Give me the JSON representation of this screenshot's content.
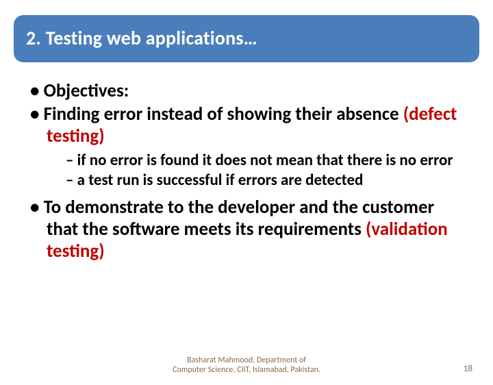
{
  "title": "2. Testing web applications…",
  "bullets": {
    "b1": "Objectives:",
    "b2_pre": "Finding error instead of showing their absence ",
    "b2_red": "(defect testing)",
    "sub1_pre": "if no error is found it ",
    "sub1_bold": "does not mean",
    "sub1_post": " that there is no error",
    "sub2_pre": "a test run is ",
    "sub2_bold": "successful",
    "sub2_post": " if errors are detected",
    "b3_pre": "To demonstrate to the developer and the customer that the software meets its requirements ",
    "b3_red": "(validation testing)"
  },
  "footer": {
    "line1": "Basharat Mahmood, Department of",
    "line2": "Computer Science, CIIT, Islamabad, Pakistan."
  },
  "page_number": "18"
}
